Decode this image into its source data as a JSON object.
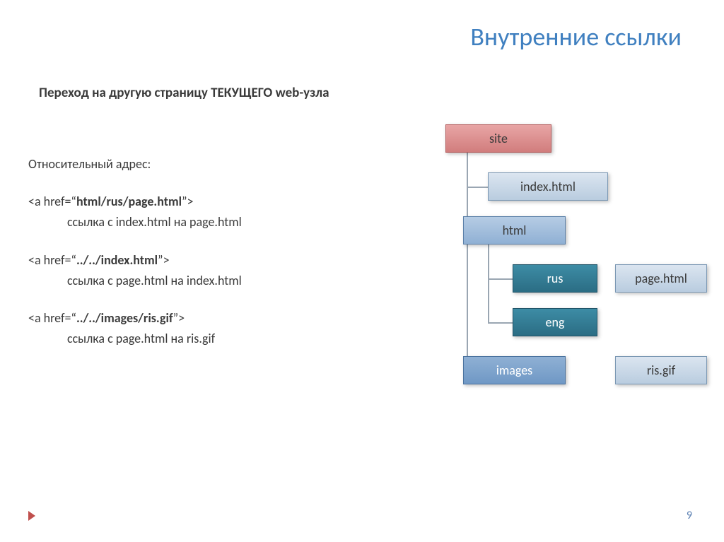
{
  "title": "Внутренние ссылки",
  "subtitle": "Переход на другую страницу ТЕКУЩЕГО web-узла",
  "left": {
    "heading": "Относительный адрес:",
    "ex1_code": "<a href=\"html/rus/page.html\">",
    "ex1_desc": "ссылка с index.html на page.html",
    "ex2_code": "<a href=\"../../index.html\">",
    "ex2_desc": "ссылка с page.html на index.html",
    "ex3_code": "<a href=\"../../images/ris.gif\">",
    "ex3_desc": "ссылка с page.html на ris.gif"
  },
  "nodes": {
    "site": "site",
    "index": "index.html",
    "html": "html",
    "rus": "rus",
    "page": "page.html",
    "eng": "eng",
    "images": "images",
    "ris": "ris.gif"
  },
  "page_number": "9",
  "chart_data": {
    "type": "tree",
    "root": "site",
    "edges": [
      [
        "site",
        "index.html"
      ],
      [
        "site",
        "html"
      ],
      [
        "site",
        "images"
      ],
      [
        "html",
        "rus"
      ],
      [
        "html",
        "eng"
      ],
      [
        "rus",
        "page.html"
      ],
      [
        "images",
        "ris.gif"
      ]
    ],
    "node_styles": {
      "site": "root-folder",
      "html": "folder",
      "rus": "folder-dark",
      "eng": "folder-dark",
      "images": "folder",
      "index.html": "file",
      "page.html": "file",
      "ris.gif": "file"
    }
  }
}
